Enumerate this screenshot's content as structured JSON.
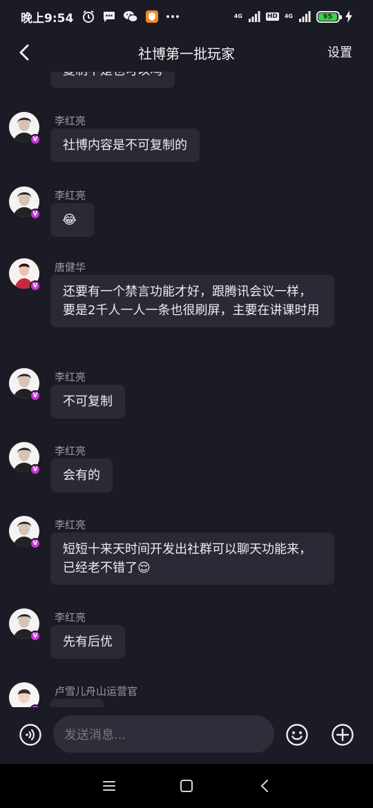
{
  "status_bar": {
    "time": "晚上9:54",
    "network1": "4G",
    "network2": "4G",
    "hd": "HD",
    "battery": "95",
    "battery_level": 0.95
  },
  "header": {
    "title": "社博第一批玩家",
    "settings_label": "设置"
  },
  "messages": [
    {
      "sender": "",
      "text": "复制不是也可以吗"
    },
    {
      "sender": "李红亮",
      "text": "社博内容是不可复制的"
    },
    {
      "sender": "李红亮",
      "text": "😂"
    },
    {
      "sender": "唐健华",
      "text": "还要有一个禁言功能才好，跟腾讯会议一样，要是2千人一人一条也很刷屏，主要在讲课时用"
    },
    {
      "sender": "李红亮",
      "text": "不可复制"
    },
    {
      "sender": "李红亮",
      "text": "会有的"
    },
    {
      "sender": "李红亮",
      "text": "短短十来天时间开发出社群可以聊天功能来，已经老不错了😌"
    },
    {
      "sender": "李红亮",
      "text": "先有后优"
    },
    {
      "sender": "卢雪儿舟山运营官",
      "text": ""
    }
  ],
  "badge_letter": "V",
  "input": {
    "placeholder": "发送消息..."
  }
}
